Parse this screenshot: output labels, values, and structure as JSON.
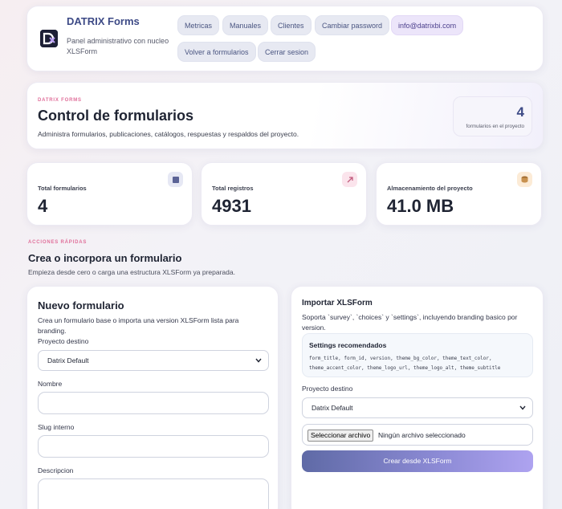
{
  "header": {
    "brand_name": "DATRIX Forms",
    "brand_subtitle": "Panel administrativo con nucleo XLSForm",
    "nav": [
      {
        "label": "Metricas"
      },
      {
        "label": "Manuales"
      },
      {
        "label": "Clientes"
      },
      {
        "label": "Cambiar password"
      },
      {
        "label": "info@datrixbi.com"
      },
      {
        "label": "Volver a formularios"
      },
      {
        "label": "Cerrar sesion"
      }
    ]
  },
  "hero": {
    "eyebrow": "DATRIX FORMS",
    "title": "Control de formularios",
    "description": "Administra formularios, publicaciones, catálogos, respuestas y respaldos del proyecto.",
    "stat_value": "4",
    "stat_label": "formularios en el proyecto"
  },
  "stats": [
    {
      "label": "Total formularios",
      "value": "4",
      "icon": "square-icon",
      "icon_bg": "#e6e8f4",
      "icon_color": "#5b6396"
    },
    {
      "label": "Total registros",
      "value": "4931",
      "icon": "arrow-up-right-icon",
      "icon_bg": "#fbe4ec",
      "icon_color": "#c25c7e"
    },
    {
      "label": "Almacenamiento del proyecto",
      "value": "41.0 MB",
      "icon": "database-icon",
      "icon_bg": "#fcebd6",
      "icon_color": "#a06a2e"
    }
  ],
  "quick_actions": {
    "eyebrow": "ACCIONES RÁPIDAS",
    "title": "Crea o incorpora un formulario",
    "description": "Empieza desde cero o carga una estructura XLSForm ya preparada."
  },
  "new_form": {
    "title": "Nuevo formulario",
    "description": "Crea un formulario base o importa una version XLSForm lista para branding.",
    "project_label": "Proyecto destino",
    "project_value": "Datrix Default",
    "name_label": "Nombre",
    "name_value": "",
    "slug_label": "Slug interno",
    "slug_value": "",
    "desc_label": "Descripcion",
    "desc_value": ""
  },
  "import_form": {
    "title": "Importar XLSForm",
    "description": "Soporta `survey`, `choices` y `settings`, incluyendo branding basico por version.",
    "settings_title": "Settings recomendados",
    "settings_fields": "form_title, form_id, version, theme_bg_color, theme_text_color, theme_accent_color, theme_logo_url, theme_logo_alt, theme_subtitle",
    "project_label": "Proyecto destino",
    "project_value": "Datrix Default",
    "file_button": "Seleccionar archivo",
    "file_status": "Ningún archivo seleccionado",
    "submit_label": "Crear desde XLSForm"
  },
  "colors": {
    "brand": "#3d4a86",
    "accent_pink": "#e06f9a",
    "button_gradient_start": "#5f6aa6",
    "button_gradient_end": "#aea3f0"
  }
}
